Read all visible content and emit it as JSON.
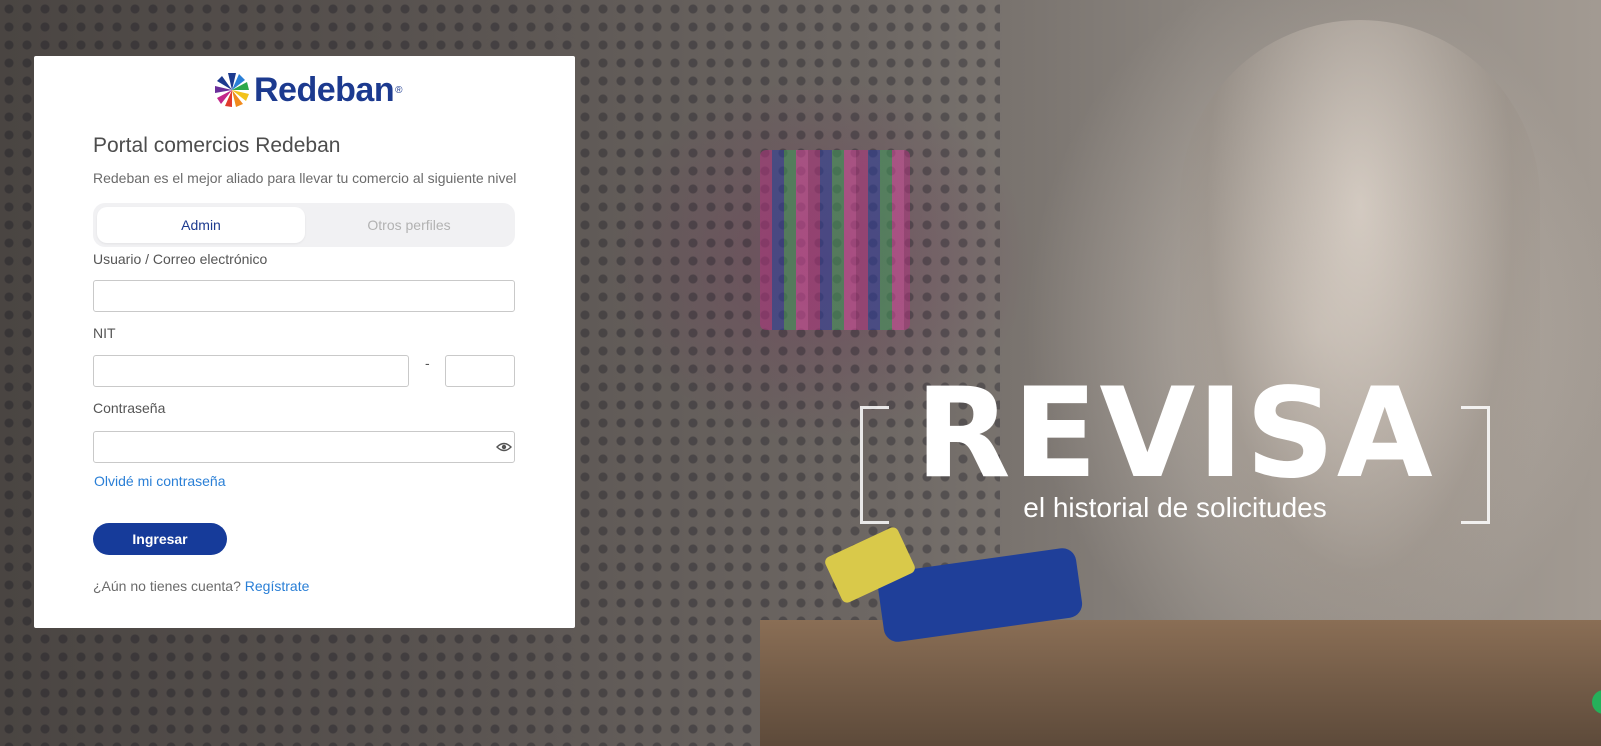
{
  "brand": {
    "logo_text": "Redeban",
    "logo_reg": "®",
    "primary_color": "#1c3a8f",
    "button_color": "#163b9a",
    "link_color": "#2a7fd6"
  },
  "hero": {
    "title": "REVISA",
    "subtitle": "el historial de solicitudes"
  },
  "login": {
    "title": "Portal comercios Redeban",
    "subtitle": "Redeban es el mejor aliado para llevar tu comercio al siguiente nivel",
    "tabs": [
      {
        "label": "Admin",
        "active": true
      },
      {
        "label": "Otros perfiles",
        "active": false
      }
    ],
    "user_label": "Usuario / Correo electrónico",
    "user_value": "",
    "nit_label": "NIT",
    "nit_value": "",
    "nit_separator": "-",
    "nit_dv_value": "",
    "password_label": "Contraseña",
    "password_value": "",
    "forgot_link": "Olvidé mi contraseña",
    "submit_label": "Ingresar",
    "signup_prompt": "¿Aún no tienes cuenta?",
    "signup_link": "Regístrate"
  },
  "icons": {
    "password_toggle": "eye-icon",
    "logo_mark": "redeban-logo-icon",
    "chat": "chat-bubble-icon"
  }
}
